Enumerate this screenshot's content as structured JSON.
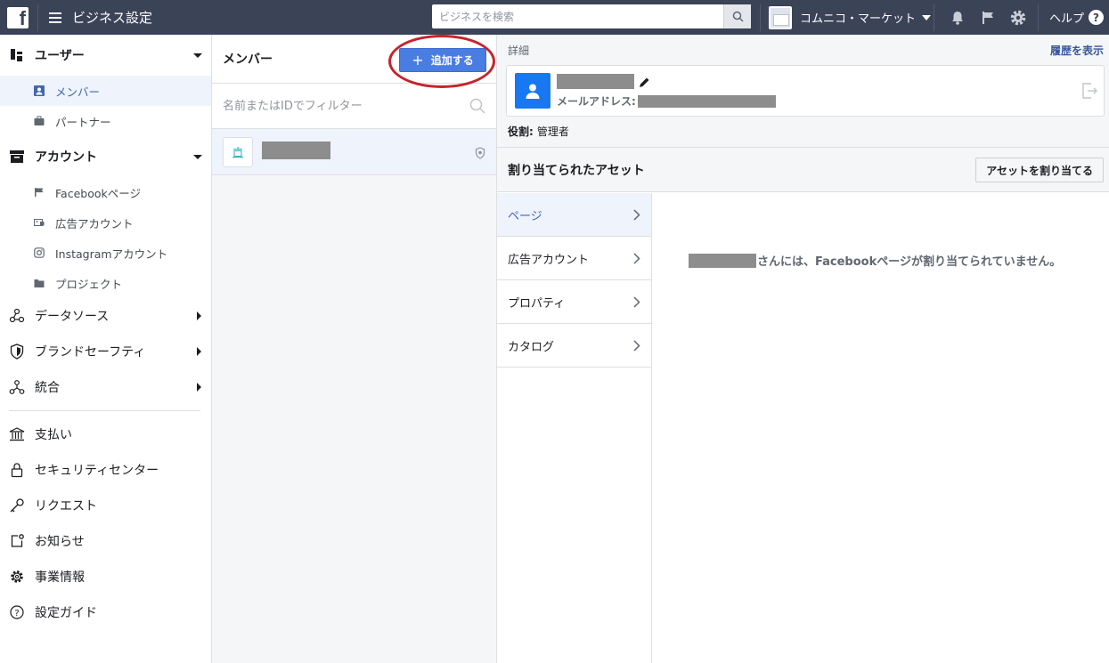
{
  "topbar": {
    "logo": "f",
    "title": "ビジネス設定",
    "search_placeholder": "ビジネスを検索",
    "business_name": "コムニコ・マーケット",
    "help_label": "ヘルプ",
    "help_glyph": "?",
    "icons": [
      "bell-icon",
      "flag-icon",
      "gear-icon"
    ]
  },
  "sidebar": {
    "users": {
      "label": "ユーザー",
      "items": [
        {
          "label": "メンバー",
          "icon": "person-icon"
        },
        {
          "label": "パートナー",
          "icon": "briefcase-icon"
        }
      ]
    },
    "accounts": {
      "label": "アカウント",
      "items": [
        {
          "label": "Facebookページ",
          "icon": "flag-icon"
        },
        {
          "label": "広告アカウント",
          "icon": "ad-account-icon"
        },
        {
          "label": "Instagramアカウント",
          "icon": "instagram-icon"
        },
        {
          "label": "プロジェクト",
          "icon": "folder-icon"
        }
      ]
    },
    "collapsed": [
      {
        "label": "データソース",
        "icon": "data-source-icon"
      },
      {
        "label": "ブランドセーフティ",
        "icon": "shield-icon"
      },
      {
        "label": "統合",
        "icon": "integration-icon"
      }
    ],
    "bottom": [
      {
        "label": "支払い",
        "icon": "bank-icon"
      },
      {
        "label": "セキュリティセンター",
        "icon": "lock-icon"
      },
      {
        "label": "リクエスト",
        "icon": "key-icon"
      },
      {
        "label": "お知らせ",
        "icon": "notification-icon"
      },
      {
        "label": "事業情報",
        "icon": "gear-icon"
      },
      {
        "label": "設定ガイド",
        "icon": "question-icon"
      }
    ]
  },
  "members": {
    "title": "メンバー",
    "add_plus": "+",
    "add_label": "追加する",
    "filter_placeholder": "名前またはIDでフィルター"
  },
  "detail": {
    "label": "詳細",
    "history_link": "履歴を表示",
    "email_label": "メールアドレス:",
    "role_label": "役割:",
    "role_value": "管理者",
    "assets_title": "割り当てられたアセット",
    "assign_button": "アセットを割り当てる",
    "asset_tabs": [
      {
        "label": "ページ",
        "active": true
      },
      {
        "label": "広告アカウント",
        "active": false
      },
      {
        "label": "プロパティ",
        "active": false
      },
      {
        "label": "カタログ",
        "active": false
      }
    ],
    "empty_message": "さんには、Facebookページが割り当てられていません。"
  },
  "colors": {
    "topbar": "#3b4357",
    "primary_button": "#4a7de2",
    "highlight_ring": "#c7232a",
    "active_bg": "#eef3fc",
    "link": "#385898"
  }
}
